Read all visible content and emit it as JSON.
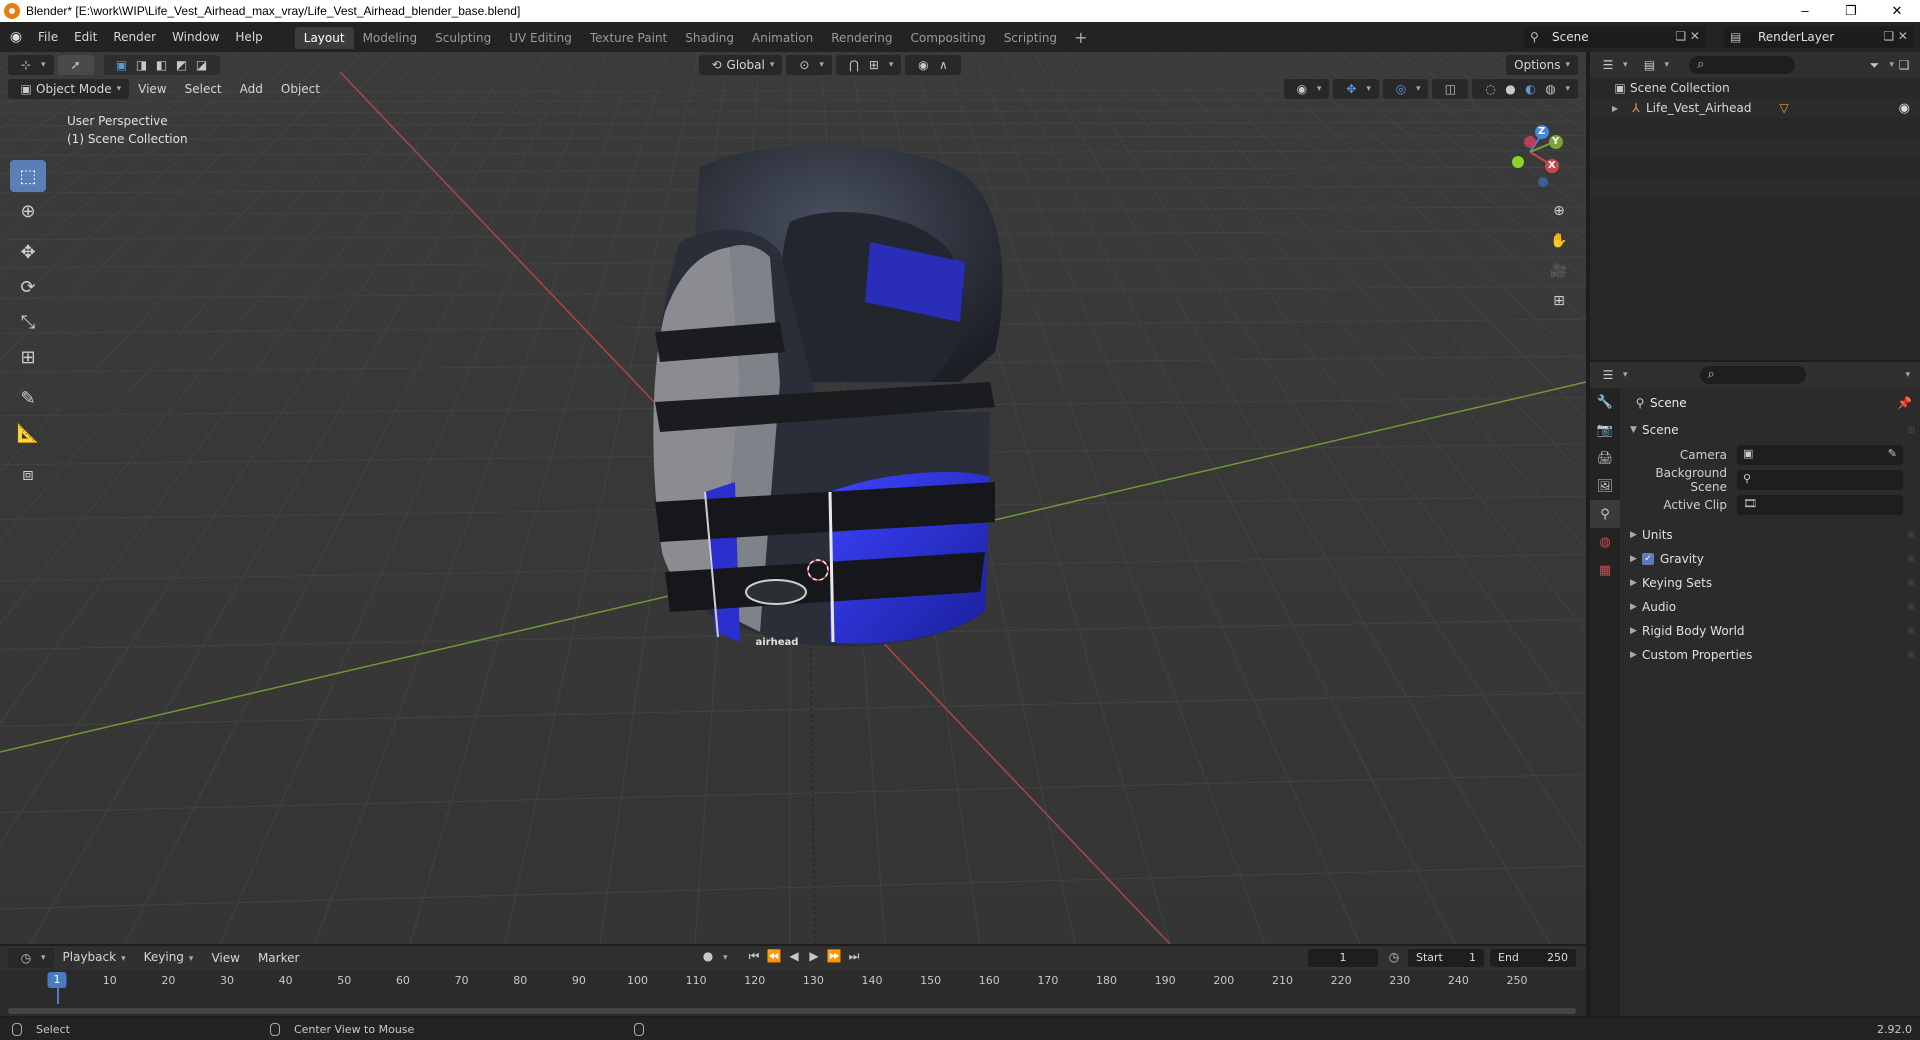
{
  "window": {
    "title": "Blender* [E:\\work\\WIP\\Life_Vest_Airhead_max_vray/Life_Vest_Airhead_blender_base.blend]",
    "minimize": "–",
    "restore": "❐",
    "close": "✕"
  },
  "menu": {
    "file": "File",
    "edit": "Edit",
    "render": "Render",
    "window": "Window",
    "help": "Help"
  },
  "workspaces": [
    "Layout",
    "Modeling",
    "Sculpting",
    "UV Editing",
    "Texture Paint",
    "Shading",
    "Animation",
    "Rendering",
    "Compositing",
    "Scripting"
  ],
  "active_workspace": "Layout",
  "scene_name": "Scene",
  "render_layer": "RenderLayer",
  "viewport": {
    "transform_orientation": "Global",
    "options": "Options",
    "mode": "Object Mode",
    "menus": {
      "view": "View",
      "select": "Select",
      "add": "Add",
      "object": "Object"
    },
    "info_perspective": "User Perspective",
    "info_collection": "(1) Scene Collection",
    "gizmo": {
      "x": "X",
      "y": "Y",
      "z": "Z"
    },
    "vest_logo": "airhead"
  },
  "outliner": {
    "root": "Scene Collection",
    "items": [
      {
        "label": "Life_Vest_Airhead"
      }
    ]
  },
  "properties": {
    "title": "Scene",
    "section": "Scene",
    "camera_label": "Camera",
    "background_scene_label": "Background Scene",
    "active_clip_label": "Active Clip",
    "panels": [
      "Units",
      "Gravity",
      "Keying Sets",
      "Audio",
      "Rigid Body World",
      "Custom Properties"
    ],
    "gravity_checked": true
  },
  "timeline": {
    "menus": {
      "playback": "Playback",
      "keying": "Keying",
      "view": "View",
      "marker": "Marker"
    },
    "current_frame": "1",
    "start_label": "Start",
    "start_value": "1",
    "end_label": "End",
    "end_value": "250",
    "ruler": [
      "1",
      "10",
      "20",
      "30",
      "40",
      "50",
      "60",
      "70",
      "80",
      "90",
      "100",
      "110",
      "120",
      "130",
      "140",
      "150",
      "160",
      "170",
      "180",
      "190",
      "200",
      "210",
      "220",
      "230",
      "240",
      "250"
    ]
  },
  "status": {
    "left_action": "Select",
    "middle_action": "Center View to Mouse",
    "version": "2.92.0"
  },
  "colors": {
    "accent": "#4a7ac2",
    "x_axis": "#c94a4a",
    "y_axis": "#7ba33a",
    "z_axis": "#4a86d8",
    "vest_blue": "#2a2fd0",
    "vest_black": "#262a33"
  }
}
